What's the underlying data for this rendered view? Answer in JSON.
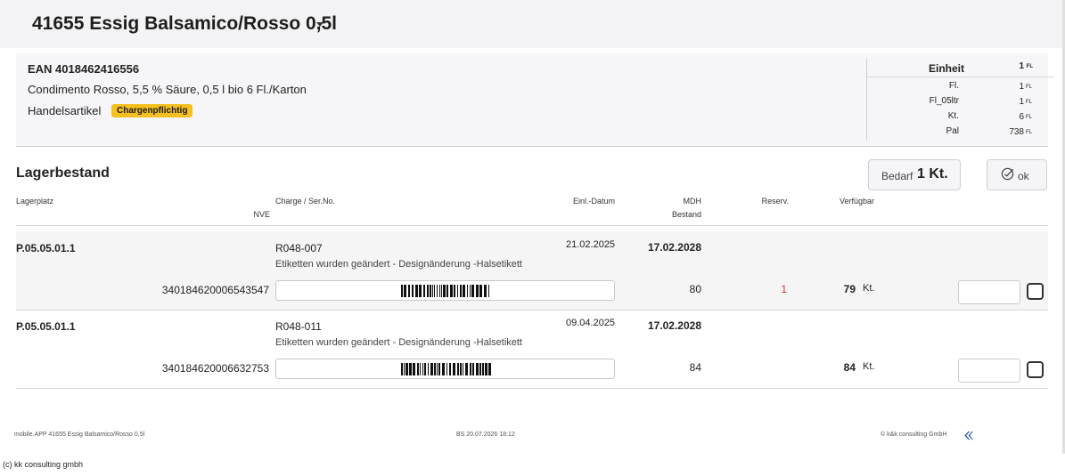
{
  "header": {
    "title": "41655 Essig Balsamico/Rosso 0,5l"
  },
  "article": {
    "ean": "EAN 4018462416556",
    "description": "Condimento Rosso, 5,5 % Säure, 0,5 l bio 6 Fl./Karton",
    "type": "Handelsartikel",
    "badge": "Chargenpflichtig",
    "badge_color": "#f5c020"
  },
  "units": {
    "header": {
      "label": "Einheit",
      "value": "1",
      "unit": "FL"
    },
    "rows": [
      {
        "label": "Fl.",
        "value": "1",
        "unit": "FL"
      },
      {
        "label": "Fl_05ltr",
        "value": "1",
        "unit": "FL"
      },
      {
        "label": "Kt.",
        "value": "6",
        "unit": "FL"
      },
      {
        "label": "Pal",
        "value": "738",
        "unit": "FL"
      }
    ]
  },
  "stock": {
    "title": "Lagerbestand",
    "bedarf_label": "Bedarf",
    "bedarf_value": "1 Kt.",
    "ok_label": "ok",
    "columns": {
      "lagerplatz": "Lagerplatz",
      "nve": "NVE",
      "charge": "Charge / Ser.No.",
      "datum": "Einl.-Datum",
      "mdh": "MDH",
      "bestand": "Bestand",
      "reserv": "Reserv.",
      "verfuegbar": "Verfügbar"
    },
    "rows": [
      {
        "lagerplatz": "P.05.05.01.1",
        "charge": "R048-007",
        "note": "Etiketten wurden geändert - Designänderung -Halsetikett",
        "datum": "21.02.2025",
        "mdh": "17.02.2028",
        "nve": "340184620006543547",
        "bestand": "80",
        "reserv": "1",
        "verfuegbar": "79",
        "unit": "Kt."
      },
      {
        "lagerplatz": "P.05.05.01.1",
        "charge": "R048-011",
        "note": "Etiketten wurden geändert - Designänderung -Halsetikett",
        "datum": "09.04.2025",
        "mdh": "17.02.2028",
        "nve": "340184620006632753",
        "bestand": "84",
        "reserv": "",
        "verfuegbar": "84",
        "unit": "Kt."
      }
    ]
  },
  "footer": {
    "left": "mobile.APP 41655 Essig Balsamico/Rosso 0,5l",
    "center": "BS 20.07.2026 18:12",
    "right": "© k&k consulting GmbH",
    "right_icon": "double-chevron-left-icon",
    "copyright": "(c) kk consulting gmbh"
  }
}
